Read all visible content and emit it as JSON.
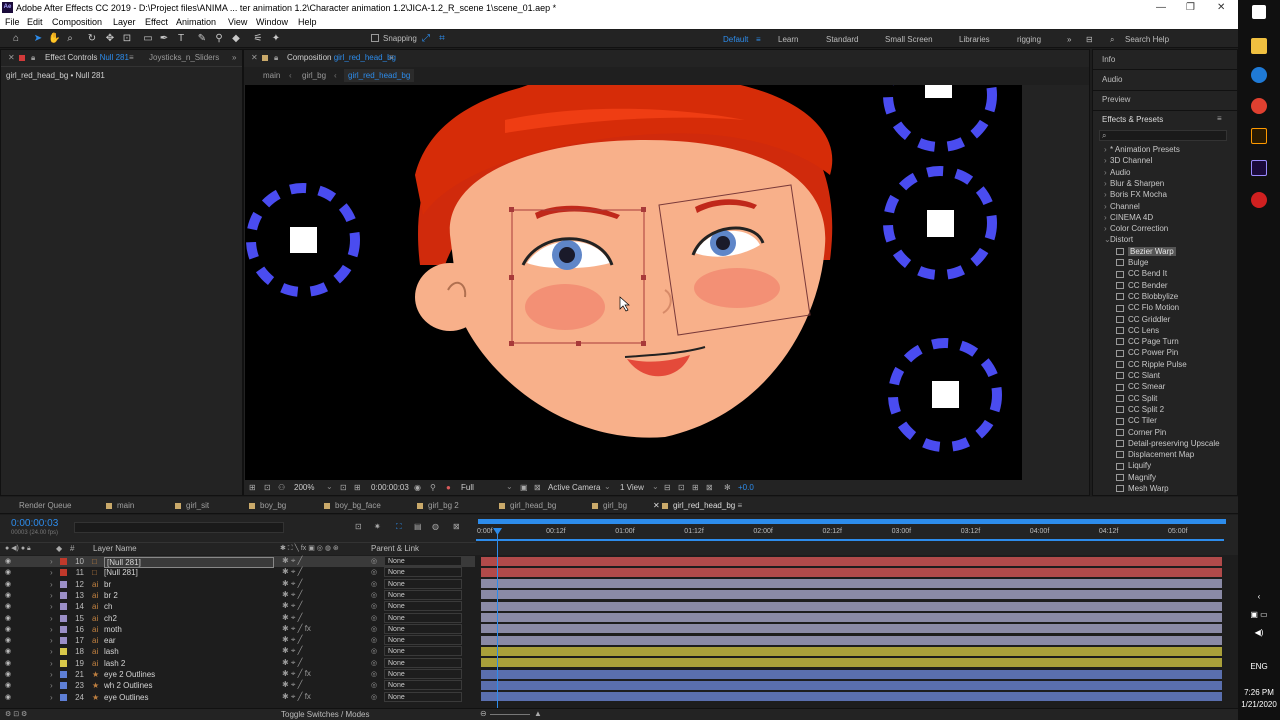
{
  "window": {
    "title": "Adobe After Effects CC 2019 - D:\\Project files\\ANIMA ... ter animation 1.2\\Character animation 1.2\\JICA-1.2_R_scene 1\\scene_01.aep *",
    "controls": [
      "—",
      "❐",
      "✕"
    ]
  },
  "menu": [
    "File",
    "Edit",
    "Composition",
    "Layer",
    "Effect",
    "Animation",
    "View",
    "Window",
    "Help"
  ],
  "toolbar": {
    "snapping_label": "Snapping",
    "workspaces": [
      "Default",
      "Learn",
      "Standard",
      "Small Screen",
      "Libraries",
      "rigging"
    ],
    "active_workspace": "Default",
    "search_placeholder": "Search Help"
  },
  "left_panel": {
    "tab_label": "Effect Controls",
    "tab_target": "Null 281",
    "tab2": "Joysticks_n_Sliders",
    "subtitle": "girl_red_head_bg • Null 281"
  },
  "comp_panel": {
    "tab_prefix": "Composition",
    "tab_name": "girl_red_head_bg",
    "breadcrumbs": [
      "main",
      "girl_bg",
      "girl_red_head_bg"
    ],
    "zoom": "200%",
    "timecode": "0:00:00:03",
    "resolution": "Full",
    "camera": "Active Camera",
    "views": "1 View",
    "exposure": "+0.0"
  },
  "right_panel": {
    "tabs": [
      "Info",
      "Audio",
      "Preview",
      "Effects & Presets"
    ],
    "search_placeholder": "",
    "categories": [
      "* Animation Presets",
      "3D Channel",
      "Audio",
      "Blur & Sharpen",
      "Boris FX Mocha",
      "Channel",
      "CINEMA 4D",
      "Color Correction",
      "Distort"
    ],
    "distort_effects": [
      "Bezier Warp",
      "Bulge",
      "CC Bend It",
      "CC Bender",
      "CC Blobbylize",
      "CC Flo Motion",
      "CC Griddler",
      "CC Lens",
      "CC Page Turn",
      "CC Power Pin",
      "CC Ripple Pulse",
      "CC Slant",
      "CC Smear",
      "CC Split",
      "CC Split 2",
      "CC Tiler",
      "Corner Pin",
      "Detail-preserving Upscale",
      "Displacement Map",
      "Liquify",
      "Magnify",
      "Mesh Warp"
    ],
    "selected_effect": "Bezier Warp"
  },
  "timeline": {
    "comp_tabs": [
      "Render Queue",
      "main",
      "girl_sit",
      "boy_bg",
      "boy_bg_face",
      "girl_bg 2",
      "girl_head_bg",
      "girl_bg",
      "girl_red_head_bg"
    ],
    "active_tab": "girl_red_head_bg",
    "timecode": "0:00:00:03",
    "fps_info": "00003 (24.00 fps)",
    "col_layer_name": "Layer Name",
    "col_parent": "Parent & Link",
    "ruler": [
      "0:00f",
      "00:12f",
      "01:00f",
      "01:12f",
      "02:00f",
      "02:12f",
      "03:00f",
      "03:12f",
      "04:00f",
      "04:12f",
      "05:00f"
    ],
    "footer": "Toggle Switches / Modes",
    "layers": [
      {
        "num": "10",
        "name": "[Null 281]",
        "color": "#c0392b",
        "type": "null",
        "parent": "None",
        "fx": false
      },
      {
        "num": "11",
        "name": "[Null 281]",
        "color": "#c0392b",
        "type": "null",
        "parent": "None",
        "fx": false
      },
      {
        "num": "12",
        "name": "br",
        "color": "#9b8fc7",
        "type": "ai",
        "parent": "None",
        "fx": false
      },
      {
        "num": "13",
        "name": "br 2",
        "color": "#9b8fc7",
        "type": "ai",
        "parent": "None",
        "fx": false
      },
      {
        "num": "14",
        "name": "ch",
        "color": "#9b8fc7",
        "type": "ai",
        "parent": "None",
        "fx": false
      },
      {
        "num": "15",
        "name": "ch2",
        "color": "#9b8fc7",
        "type": "ai",
        "parent": "None",
        "fx": false
      },
      {
        "num": "16",
        "name": "moth",
        "color": "#9b8fc7",
        "type": "ai",
        "parent": "None",
        "fx": true
      },
      {
        "num": "17",
        "name": "ear",
        "color": "#9b8fc7",
        "type": "ai",
        "parent": "None",
        "fx": false
      },
      {
        "num": "18",
        "name": "lash",
        "color": "#d8c84a",
        "type": "ai",
        "parent": "None",
        "fx": false
      },
      {
        "num": "19",
        "name": "lash 2",
        "color": "#d8c84a",
        "type": "ai",
        "parent": "None",
        "fx": false
      },
      {
        "num": "21",
        "name": "eye 2 Outlines",
        "color": "#5e7fd6",
        "type": "shape",
        "parent": "None",
        "fx": true
      },
      {
        "num": "23",
        "name": "wh 2 Outlines",
        "color": "#5e7fd6",
        "type": "shape",
        "parent": "None",
        "fx": false
      },
      {
        "num": "24",
        "name": "eye Outlines",
        "color": "#5e7fd6",
        "type": "shape",
        "parent": "None",
        "fx": true
      }
    ],
    "bar_colors": [
      "#b14a4a",
      "#b14a4a",
      "#8a8aa6",
      "#8a8aa6",
      "#8a8aa6",
      "#8a8aa6",
      "#8a8aa6",
      "#8a8aa6",
      "#a9a03a",
      "#a9a03a",
      "#5a6fae",
      "#5a6fae",
      "#5a6fae"
    ]
  },
  "taskbar": {
    "lang": "ENG",
    "time": "7:26 PM",
    "date": "1/21/2020"
  }
}
